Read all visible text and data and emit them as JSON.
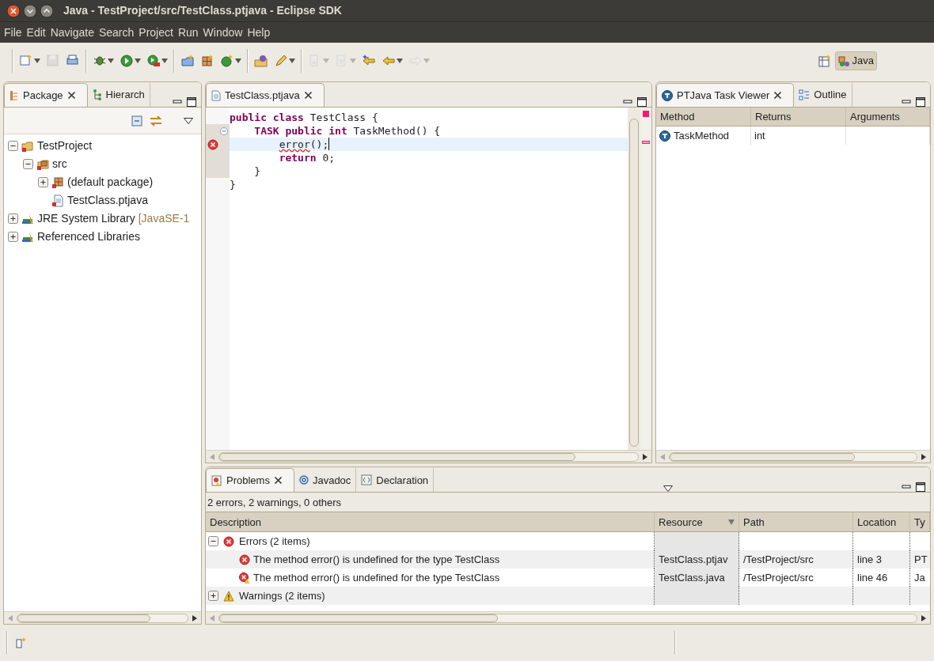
{
  "window": {
    "title": "Java - TestProject/src/TestClass.ptjava - Eclipse SDK"
  },
  "menu": [
    "File",
    "Edit",
    "Navigate",
    "Search",
    "Project",
    "Run",
    "Window",
    "Help"
  ],
  "toolbar": [
    [
      {
        "kind": "new",
        "dropdown": true,
        "disabled": false
      },
      {
        "kind": "save",
        "dropdown": false,
        "disabled": true
      },
      {
        "kind": "print",
        "dropdown": false,
        "disabled": false
      }
    ],
    [
      {
        "kind": "debug",
        "dropdown": true,
        "disabled": false
      },
      {
        "kind": "run",
        "dropdown": true,
        "disabled": false
      },
      {
        "kind": "run-ext",
        "dropdown": true,
        "disabled": false
      }
    ],
    [
      {
        "kind": "new-package",
        "dropdown": false,
        "disabled": false
      },
      {
        "kind": "new-grid",
        "dropdown": false,
        "disabled": false
      },
      {
        "kind": "new-class",
        "dropdown": true,
        "disabled": false
      }
    ],
    [
      {
        "kind": "open-type",
        "dropdown": false,
        "disabled": false
      },
      {
        "kind": "pen",
        "dropdown": true,
        "disabled": false
      }
    ],
    [
      {
        "kind": "next-annotation",
        "dropdown": true,
        "disabled": true
      },
      {
        "kind": "prev-annotation",
        "dropdown": true,
        "disabled": true
      },
      {
        "kind": "last-edit",
        "dropdown": false,
        "disabled": false
      },
      {
        "kind": "back",
        "dropdown": true,
        "disabled": false
      },
      {
        "kind": "forward",
        "dropdown": true,
        "disabled": true
      }
    ]
  ],
  "perspective": {
    "label": "Java",
    "selected": true
  },
  "package_panel": {
    "tabs": [
      {
        "label": "Package",
        "selected": true
      },
      {
        "label": "Hierarch",
        "selected": false
      }
    ],
    "tree": [
      {
        "label": "TestProject",
        "kind": "project",
        "expanded": true,
        "children": [
          {
            "label": "src",
            "kind": "source",
            "expanded": true,
            "children": [
              {
                "label": "(default package)",
                "kind": "package",
                "expanded": false
              },
              {
                "label": "TestClass.ptjava",
                "kind": "file"
              }
            ]
          }
        ]
      },
      {
        "label": "JRE System Library",
        "decoration": "[JavaSE-1",
        "kind": "library",
        "expanded": false
      },
      {
        "label": "Referenced Libraries",
        "kind": "library",
        "expanded": false
      }
    ]
  },
  "editor": {
    "tabs": [
      {
        "label": "TestClass.ptjava",
        "selected": true
      }
    ],
    "lines": [
      {
        "tokens": [
          {
            "text": "public class",
            "kind": "keyword"
          },
          {
            "text": " TestClass {",
            "kind": "plain"
          }
        ],
        "current": false,
        "in_range": false,
        "kind": "plain"
      },
      {
        "tokens": [
          {
            "text": "    TASK public int",
            "kind": "keyword"
          },
          {
            "text": " TaskMethod() {",
            "kind": "plain"
          }
        ],
        "current": false,
        "in_range": true,
        "kind": "fold"
      },
      {
        "tokens": [
          {
            "text": "        error",
            "kind": "error"
          },
          {
            "text": "();",
            "kind": "plain"
          }
        ],
        "current": true,
        "in_range": true,
        "kind": "error"
      },
      {
        "tokens": [
          {
            "text": "        return",
            "kind": "keyword"
          },
          {
            "text": " 0;",
            "kind": "plain"
          }
        ],
        "current": false,
        "in_range": true,
        "kind": "plain"
      },
      {
        "tokens": [
          {
            "text": "    }",
            "kind": "plain"
          }
        ],
        "current": false,
        "in_range": true,
        "kind": "plain"
      },
      {
        "tokens": [
          {
            "text": "}",
            "kind": "plain"
          }
        ],
        "current": false,
        "in_range": false,
        "kind": "plain"
      }
    ]
  },
  "task_viewer": {
    "tabs": [
      {
        "label": "PTJava Task Viewer",
        "selected": true
      },
      {
        "label": "Outline",
        "selected": false
      }
    ],
    "columns": [
      "Method",
      "Returns",
      "Arguments"
    ],
    "rows": [
      [
        "TaskMethod",
        "int",
        ""
      ]
    ]
  },
  "problems": {
    "tabs": [
      {
        "label": "Problems",
        "selected": true
      },
      {
        "label": "Javadoc",
        "selected": false
      },
      {
        "label": "Declaration",
        "selected": false
      }
    ],
    "summary": "2 errors, 2 warnings, 0 others",
    "columns": [
      "Description",
      "Resource",
      "Path",
      "Location",
      "Ty"
    ],
    "groups": [
      {
        "label": "Errors (2 items)",
        "kind": "error",
        "expanded": true,
        "rows": [
          {
            "kind": "error",
            "cells": [
              "The method error() is undefined for the type TestClass",
              "TestClass.ptjav",
              "/TestProject/src",
              "line 3",
              "PT"
            ]
          },
          {
            "kind": "error-warning",
            "cells": [
              "The method error() is undefined for the type TestClass",
              "TestClass.java",
              "/TestProject/src",
              "line 46",
              "Ja"
            ]
          }
        ]
      },
      {
        "label": "Warnings (2 items)",
        "kind": "warning",
        "expanded": false
      }
    ]
  }
}
